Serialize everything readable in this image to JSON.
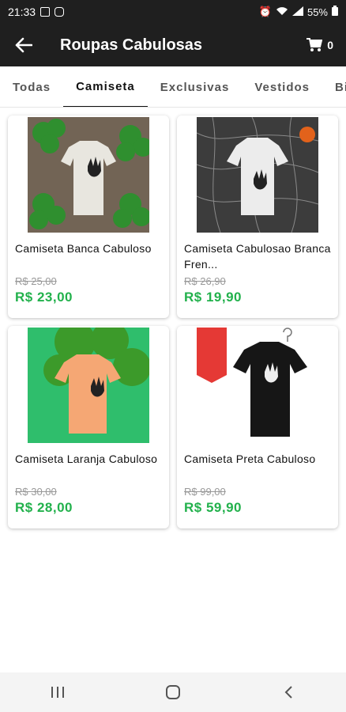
{
  "status": {
    "time": "21:33",
    "battery": "55%"
  },
  "header": {
    "title": "Roupas Cabulosas",
    "cart_count": "0"
  },
  "tabs": [
    {
      "label": "Todas"
    },
    {
      "label": "Camiseta"
    },
    {
      "label": "Exclusivas"
    },
    {
      "label": "Vestidos"
    },
    {
      "label": "Bi"
    }
  ],
  "products": [
    {
      "name": "Camiseta Banca Cabuloso",
      "old_price": "R$ 25,00",
      "price": "R$ 23,00"
    },
    {
      "name": "Camiseta Cabulosao Branca Fren...",
      "old_price": "R$ 26,90",
      "price": "R$ 19,90"
    },
    {
      "name": "Camiseta Laranja Cabuloso",
      "old_price": "R$ 30,00",
      "price": "R$ 28,00"
    },
    {
      "name": "Camiseta Preta Cabuloso",
      "old_price": "R$ 99,00",
      "price": "R$ 59,90"
    }
  ],
  "colors": {
    "bar": "#1f1f1f",
    "price": "#22b14c"
  }
}
